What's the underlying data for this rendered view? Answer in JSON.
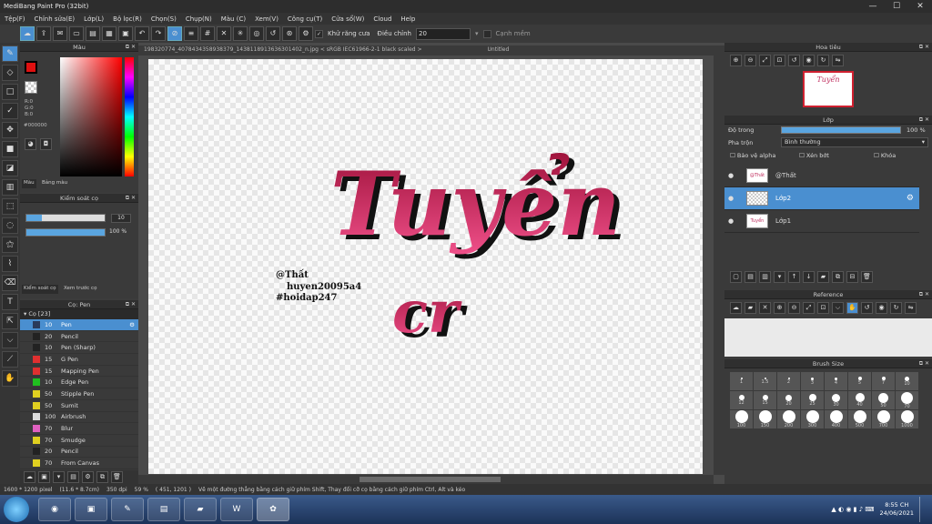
{
  "titlebar": {
    "title": "MediBang Paint Pro (32bit)",
    "min": "—",
    "max": "☐",
    "close": "✕"
  },
  "menu": [
    "Tệp(F)",
    "Chỉnh sửa(E)",
    "Lớp(L)",
    "Bộ lọc(R)",
    "Chọn(S)",
    "Chụp(N)",
    "Màu (C)",
    "Xem(V)",
    "Công cụ(T)",
    "Cửa sổ(W)",
    "Cloud",
    "Help"
  ],
  "toolbar": {
    "antialias_label": "Khử răng cưa",
    "correction_label": "Điều chỉnh",
    "correction_value": "20",
    "smooth_label": "Cạnh mềm"
  },
  "color_panel": {
    "title": "Màu",
    "r": "R:0",
    "g": "G:0",
    "b": "B:0",
    "hex": "#000000",
    "tab1": "Màu",
    "tab2": "Bảng màu"
  },
  "brush_control": {
    "title": "Kiểm soát cọ",
    "size_value": "10",
    "opacity_value": "100 %",
    "tab1": "Kiểm soát cọ",
    "tab2": "Xem trước cọ"
  },
  "brush_list": {
    "title": "Cọ: Pen",
    "group": "Cọ [23]",
    "items": [
      {
        "size": "10",
        "name": "Pen",
        "color": "#2a3a5a"
      },
      {
        "size": "20",
        "name": "Pencil",
        "color": "#222222"
      },
      {
        "size": "10",
        "name": "Pen (Sharp)",
        "color": "#222222"
      },
      {
        "size": "15",
        "name": "G Pen",
        "color": "#e03030"
      },
      {
        "size": "15",
        "name": "Mapping Pen",
        "color": "#e03030"
      },
      {
        "size": "10",
        "name": "Edge Pen",
        "color": "#20c020"
      },
      {
        "size": "50",
        "name": "Stipple Pen",
        "color": "#e0d020"
      },
      {
        "size": "50",
        "name": "Sumit",
        "color": "#e0d020"
      },
      {
        "size": "100",
        "name": "Airbrush",
        "color": "#dddddd"
      },
      {
        "size": "70",
        "name": "Blur",
        "color": "#e060c0"
      },
      {
        "size": "70",
        "name": "Smudge",
        "color": "#e0d020"
      },
      {
        "size": "20",
        "name": "Pencil",
        "color": "#222222"
      },
      {
        "size": "70",
        "name": "From Canvas",
        "color": "#e0d020"
      }
    ]
  },
  "doc_tabs": {
    "file": "198320774_4078434358938379_1438118913636301402_n.jpg < sRGB IEC61966-2-1 black scaled >",
    "untitled": "Untitled"
  },
  "canvas_text": {
    "line1": "Tuyển",
    "line2": "cr",
    "watermark1": "@Thất",
    "watermark2": "huyen20095a4",
    "watermark3": "#hoidap247"
  },
  "navigator": {
    "title": "Hoa tiêu"
  },
  "layers": {
    "title": "Lớp",
    "opacity_label": "Độ trong",
    "opacity_value": "100 %",
    "blend_label": "Pha trộn",
    "blend_value": "Bình thường",
    "protect_alpha": "Bảo vệ alpha",
    "clipping": "Xén bớt",
    "lock": "Khóa",
    "items": [
      {
        "name": "@Thất",
        "thumb": "@Thất"
      },
      {
        "name": "Lớp2",
        "thumb": ""
      },
      {
        "name": "Lớp1",
        "thumb": "Tuyển"
      }
    ]
  },
  "reference": {
    "title": "Reference"
  },
  "brush_size": {
    "title": "Brush Size",
    "sizes": [
      "1",
      "1.5",
      "2",
      "3",
      "4",
      "5",
      "7",
      "10",
      "12",
      "15",
      "20",
      "25",
      "30",
      "40",
      "50",
      "70",
      "100",
      "150",
      "200",
      "300",
      "400",
      "500",
      "700",
      "1000"
    ]
  },
  "status": {
    "dims": "1600 * 1200 pixel",
    "cm": "(11.6 * 8.7cm)",
    "dpi": "350 dpi",
    "zoom": "59 %",
    "coords": "( 451, 1201 )",
    "hint": "Vẽ một đường thẳng bằng cách giữ phím Shift, Thay đổi cỡ cọ bằng cách giữ phím Ctrl, Alt và kéo"
  },
  "taskbar": {
    "time": "8:55 CH",
    "date": "24/06/2021"
  }
}
